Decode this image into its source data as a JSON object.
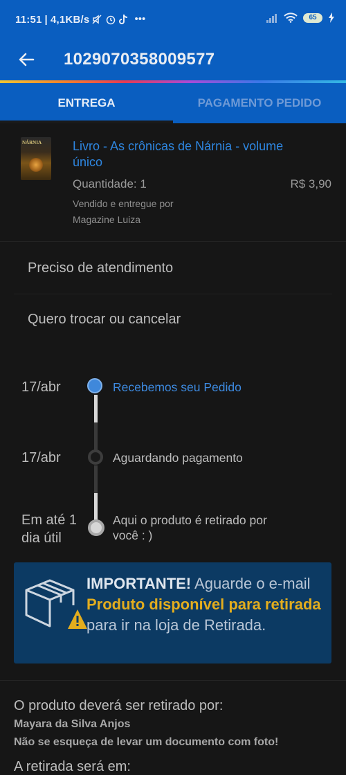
{
  "status_bar": {
    "time": "11:51",
    "network_speed": "4,1KB/s",
    "battery": "65",
    "icons": [
      "mute-icon",
      "alarm-icon",
      "tiktok-icon",
      "more-icon",
      "signal-icon",
      "wifi-icon",
      "battery-icon",
      "charging-icon"
    ]
  },
  "header": {
    "order_number": "1029070358009577",
    "back_icon": "arrow-left-icon",
    "color": "#0a5ec0"
  },
  "tabs": [
    {
      "label": "ENTREGA",
      "active": true
    },
    {
      "label": "PAGAMENTO PEDIDO",
      "active": false
    }
  ],
  "product": {
    "cover_title": "NÁRNIA",
    "name": "Livro - As crônicas de Nárnia - volume único",
    "quantity": "Quantidade: 1",
    "price": "R$ 3,90",
    "seller_label": "Vendido e entregue por",
    "seller_name": "Magazine Luiza"
  },
  "options": [
    {
      "label": "Preciso de atendimento"
    },
    {
      "label": "Quero trocar ou cancelar"
    }
  ],
  "timeline": [
    {
      "date": "17/abr",
      "label": "Recebemos seu Pedido",
      "state": "done"
    },
    {
      "date": "17/abr",
      "label": "Aguardando pagamento",
      "state": "pending"
    },
    {
      "date_line1": "Em até 1",
      "date_line2": "dia útil",
      "label_line1": "Aqui o produto é retirado por",
      "label_line2": "você : )",
      "state": "future"
    }
  ],
  "important": {
    "bold": "IMPORTANTE!",
    "text1": " Aguarde o e-mail ",
    "highlight": "Produto disponível para retirada",
    "text2": " para ir na loja de Retirada.",
    "highlight_color": "#e3ad1e"
  },
  "pickup": {
    "label": "O produto deverá ser retirado por:",
    "name": "Mayara da Silva Anjos",
    "note": "Não se esqueça de levar um documento com foto!",
    "where": "A retirada será em:"
  }
}
